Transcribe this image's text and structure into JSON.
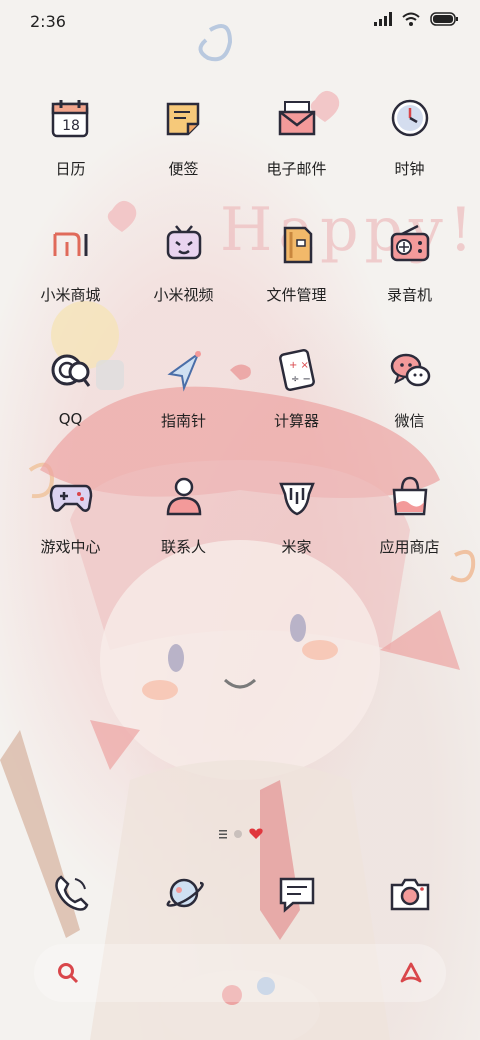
{
  "status_bar": {
    "time": "2:36"
  },
  "apps": [
    {
      "label": "日历",
      "icon": "calendar-icon"
    },
    {
      "label": "便签",
      "icon": "notes-icon"
    },
    {
      "label": "电子邮件",
      "icon": "email-icon"
    },
    {
      "label": "时钟",
      "icon": "clock-icon"
    },
    {
      "label": "小米商城",
      "icon": "mi-store-icon"
    },
    {
      "label": "小米视频",
      "icon": "tv-icon"
    },
    {
      "label": "文件管理",
      "icon": "folder-icon"
    },
    {
      "label": "录音机",
      "icon": "radio-icon"
    },
    {
      "label": "QQ",
      "icon": "qq-icon"
    },
    {
      "label": "指南针",
      "icon": "compass-icon"
    },
    {
      "label": "计算器",
      "icon": "calculator-icon"
    },
    {
      "label": "微信",
      "icon": "wechat-icon"
    },
    {
      "label": "游戏中心",
      "icon": "gamepad-icon"
    },
    {
      "label": "联系人",
      "icon": "contacts-icon"
    },
    {
      "label": "米家",
      "icon": "mijia-icon"
    },
    {
      "label": "应用商店",
      "icon": "app-store-icon"
    }
  ],
  "calendar_day": "18",
  "wallpaper_text": "Happy!",
  "colors": {
    "accent_red": "#d9464a",
    "ink": "#2b2b3a"
  }
}
